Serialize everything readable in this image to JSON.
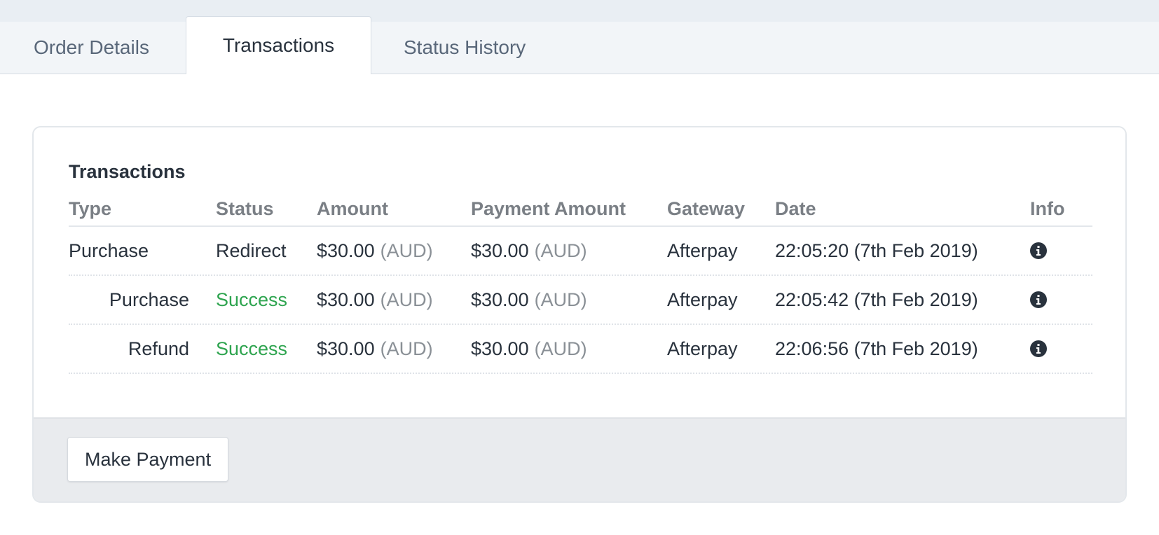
{
  "tabs": [
    {
      "label": "Order Details",
      "active": false
    },
    {
      "label": "Transactions",
      "active": true
    },
    {
      "label": "Status History",
      "active": false
    }
  ],
  "card": {
    "title": "Transactions",
    "columns": [
      "Type",
      "Status",
      "Amount",
      "Payment Amount",
      "Gateway",
      "Date",
      "Info"
    ],
    "rows": [
      {
        "type": "Purchase",
        "status": "Redirect",
        "amount": "$30.00",
        "amount_currency": "(AUD)",
        "payment_amount": "$30.00",
        "payment_currency": "(AUD)",
        "gateway": "Afterpay",
        "date": "22:05:20 (7th Feb 2019)",
        "info_icon": "info-circle-icon"
      },
      {
        "type": "Purchase",
        "status": "Success",
        "amount": "$30.00",
        "amount_currency": "(AUD)",
        "payment_amount": "$30.00",
        "payment_currency": "(AUD)",
        "gateway": "Afterpay",
        "date": "22:05:42 (7th Feb 2019)",
        "info_icon": "info-circle-icon"
      },
      {
        "type": "Refund",
        "status": "Success",
        "amount": "$30.00",
        "amount_currency": "(AUD)",
        "payment_amount": "$30.00",
        "payment_currency": "(AUD)",
        "gateway": "Afterpay",
        "date": "22:06:56 (7th Feb 2019)",
        "info_icon": "info-circle-icon"
      }
    ],
    "footer": {
      "make_payment_label": "Make Payment"
    }
  },
  "colors": {
    "success": "#2ea44f",
    "text": "#29323d",
    "muted": "#8a9096",
    "tab_bar_bg": "#f2f5f8",
    "footer_bg": "#e9ebee"
  }
}
